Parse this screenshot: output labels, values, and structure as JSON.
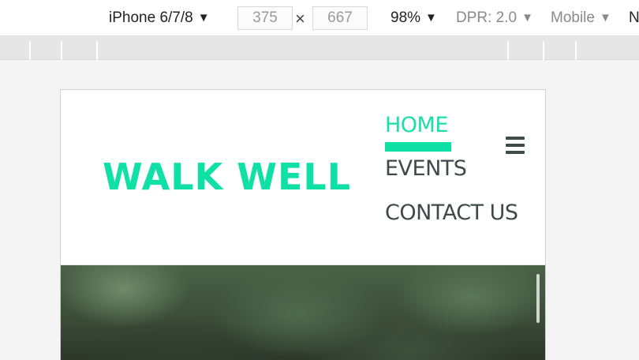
{
  "devtools": {
    "device": "iPhone 6/7/8",
    "width": "375",
    "height": "667",
    "times_symbol": "×",
    "zoom": "98%",
    "dpr": "DPR: 2.0",
    "mode": "Mobile",
    "throttle_cut": "N",
    "caret": "▼"
  },
  "site": {
    "logo": "WALK WELL",
    "nav": [
      {
        "label": "HOME",
        "active": true
      },
      {
        "label": "EVENTS",
        "active": false
      },
      {
        "label": "CONTACT US",
        "active": false
      }
    ],
    "menu_icon": "hamburger-menu-icon"
  },
  "colors": {
    "accent": "#0fe0a6",
    "nav_text": "#3e4a4a",
    "hamburger": "#3d4b4a"
  }
}
